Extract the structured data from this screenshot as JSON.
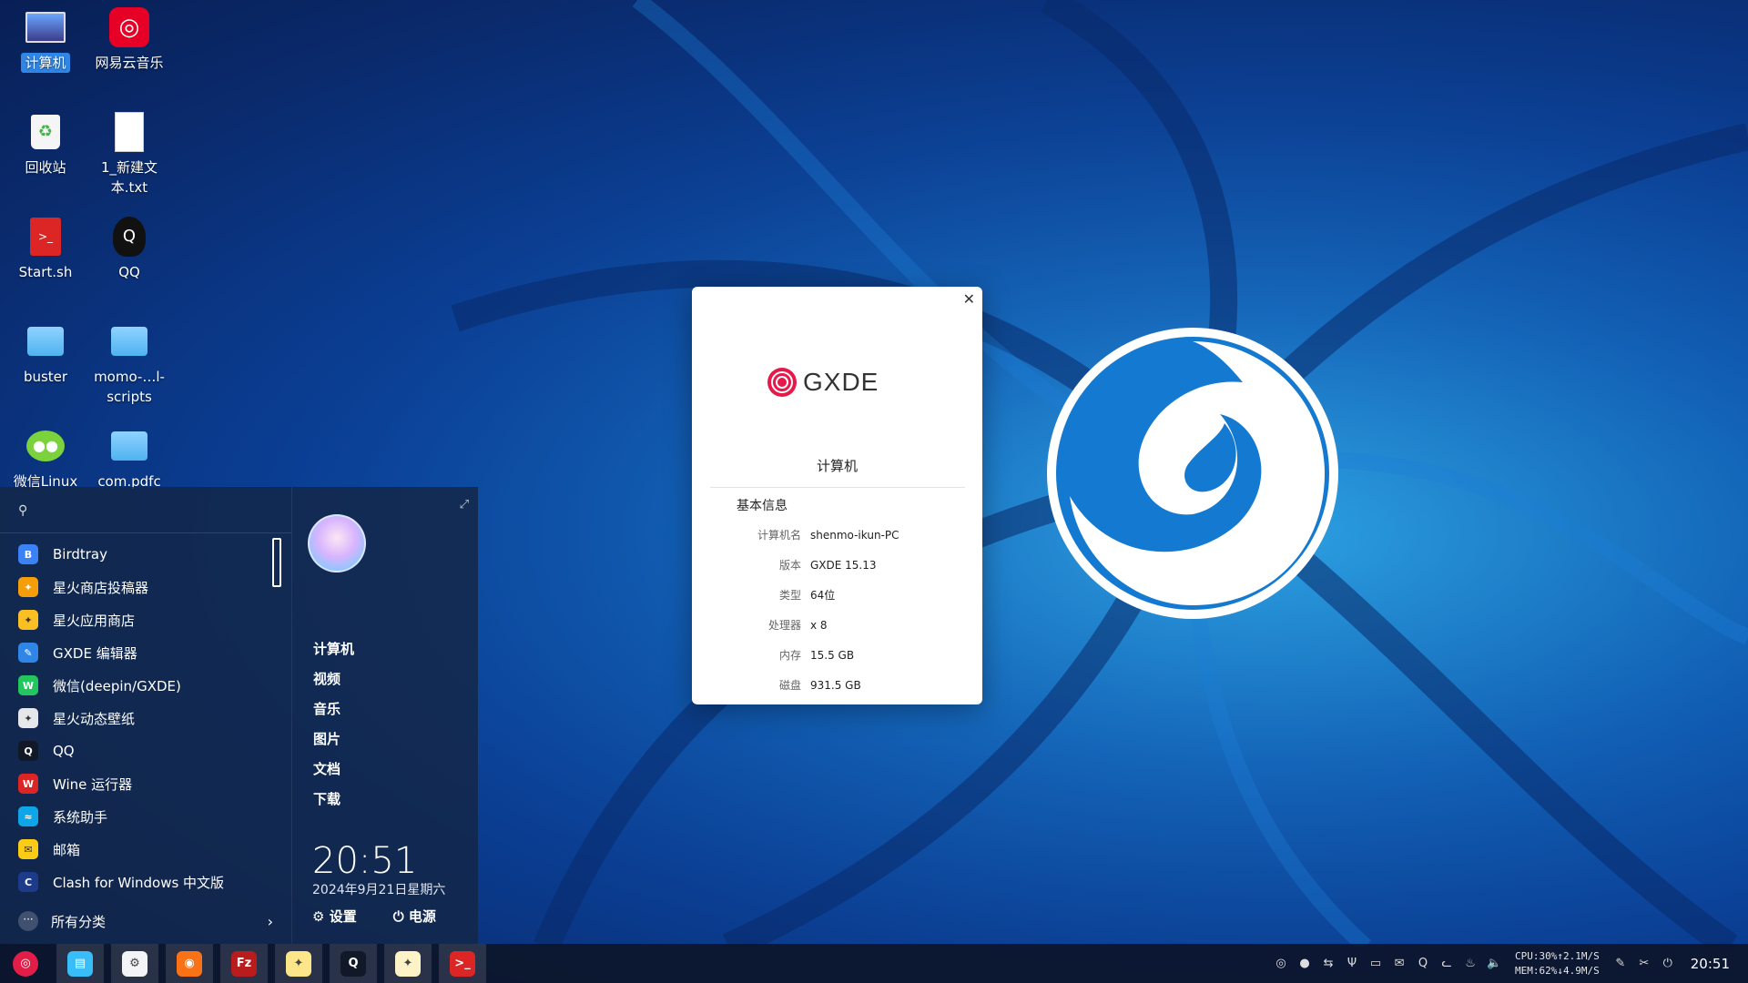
{
  "desktop": {
    "icons": [
      {
        "label": "计算机",
        "icon": "computer-icon",
        "selected": true
      },
      {
        "label": "网易云音乐",
        "icon": "netease-music-icon"
      },
      {
        "label": "回收站",
        "icon": "trash-icon"
      },
      {
        "label": "1_新建文本.txt",
        "icon": "text-file-icon"
      },
      {
        "label": "Start.sh",
        "icon": "shell-script-icon"
      },
      {
        "label": "QQ",
        "icon": "qq-icon"
      },
      {
        "label": "buster",
        "icon": "folder-icon"
      },
      {
        "label": "momo-…l-scripts",
        "icon": "folder-icon"
      },
      {
        "label": "微信Linux",
        "icon": "wechat-icon"
      },
      {
        "label": "com.pdfc",
        "icon": "folder-icon"
      }
    ]
  },
  "start_menu": {
    "search_icon": "search-icon",
    "apps": [
      {
        "label": "Birdtray",
        "color": "#3b82f6",
        "glyph": "B"
      },
      {
        "label": "星火商店投稿器",
        "color": "#f59e0b",
        "glyph": "✦"
      },
      {
        "label": "星火应用商店",
        "color": "#fbbf24",
        "glyph": "✦"
      },
      {
        "label": "GXDE 编辑器",
        "color": "#2f86e6",
        "glyph": "✎"
      },
      {
        "label": "微信(deepin/GXDE)",
        "color": "#22c55e",
        "glyph": "W"
      },
      {
        "label": "星火动态壁纸",
        "color": "#e5e7eb",
        "glyph": "✦"
      },
      {
        "label": "QQ",
        "color": "#111827",
        "glyph": "Q"
      },
      {
        "label": "Wine 运行器",
        "color": "#dc2626",
        "glyph": "W"
      },
      {
        "label": "系统助手",
        "color": "#0ea5e9",
        "glyph": "≈"
      },
      {
        "label": "邮箱",
        "color": "#facc15",
        "glyph": "✉"
      },
      {
        "label": "Clash for Windows 中文版",
        "color": "#1e3a8a",
        "glyph": "C"
      }
    ],
    "all_categories": "所有分类",
    "places": [
      "计算机",
      "视频",
      "音乐",
      "图片",
      "文档",
      "下载"
    ],
    "clock": "20:51",
    "date": "2024年9月21日星期六",
    "settings": "设置",
    "power": "电源"
  },
  "dialog": {
    "brand": "GXDE",
    "title": "计算机",
    "section": "基本信息",
    "rows": [
      {
        "key": "计算机名",
        "value": "shenmo-ikun-PC"
      },
      {
        "key": "版本",
        "value": "GXDE 15.13"
      },
      {
        "key": "类型",
        "value": "64位"
      },
      {
        "key": "处理器",
        "value": "x 8"
      },
      {
        "key": "内存",
        "value": "15.5 GB"
      },
      {
        "key": "磁盘",
        "value": "931.5 GB"
      }
    ]
  },
  "taskbar": {
    "apps": [
      {
        "name": "launcher",
        "icon": "gxde-launcher-icon",
        "color": "#e11d48",
        "glyph": "◎"
      },
      {
        "name": "file-manager",
        "icon": "file-manager-icon",
        "color": "#38bdf8",
        "glyph": "▤"
      },
      {
        "name": "control-center",
        "icon": "settings-gear-icon",
        "color": "#f3f4f6",
        "glyph": "⚙"
      },
      {
        "name": "firefox",
        "icon": "firefox-icon",
        "color": "#f97316",
        "glyph": "◉"
      },
      {
        "name": "filezilla",
        "icon": "filezilla-icon",
        "color": "#b91c1c",
        "glyph": "Fz"
      },
      {
        "name": "spark-store",
        "icon": "spark-store-icon",
        "color": "#fde68a",
        "glyph": "✦"
      },
      {
        "name": "qq",
        "icon": "qq-icon",
        "color": "#111827",
        "glyph": "Q"
      },
      {
        "name": "spark-uploader",
        "icon": "spark-uploader-icon",
        "color": "#fef3c7",
        "glyph": "✦"
      },
      {
        "name": "terminal",
        "icon": "terminal-icon",
        "color": "#dc2626",
        "glyph": ">_"
      }
    ],
    "tray_icons": [
      "netease-tray-icon",
      "wechat-tray-icon",
      "network-tray-icon",
      "usb-tray-icon",
      "clipboard-tray-icon",
      "mail-tray-icon",
      "qq-tray-icon",
      "cat-tray-icon",
      "fire-tray-icon",
      "volume-icon"
    ],
    "cpu": "CPU:30%↑2.1M/S",
    "mem": "MEM:62%↓4.9M/S",
    "clock": "20:51"
  }
}
